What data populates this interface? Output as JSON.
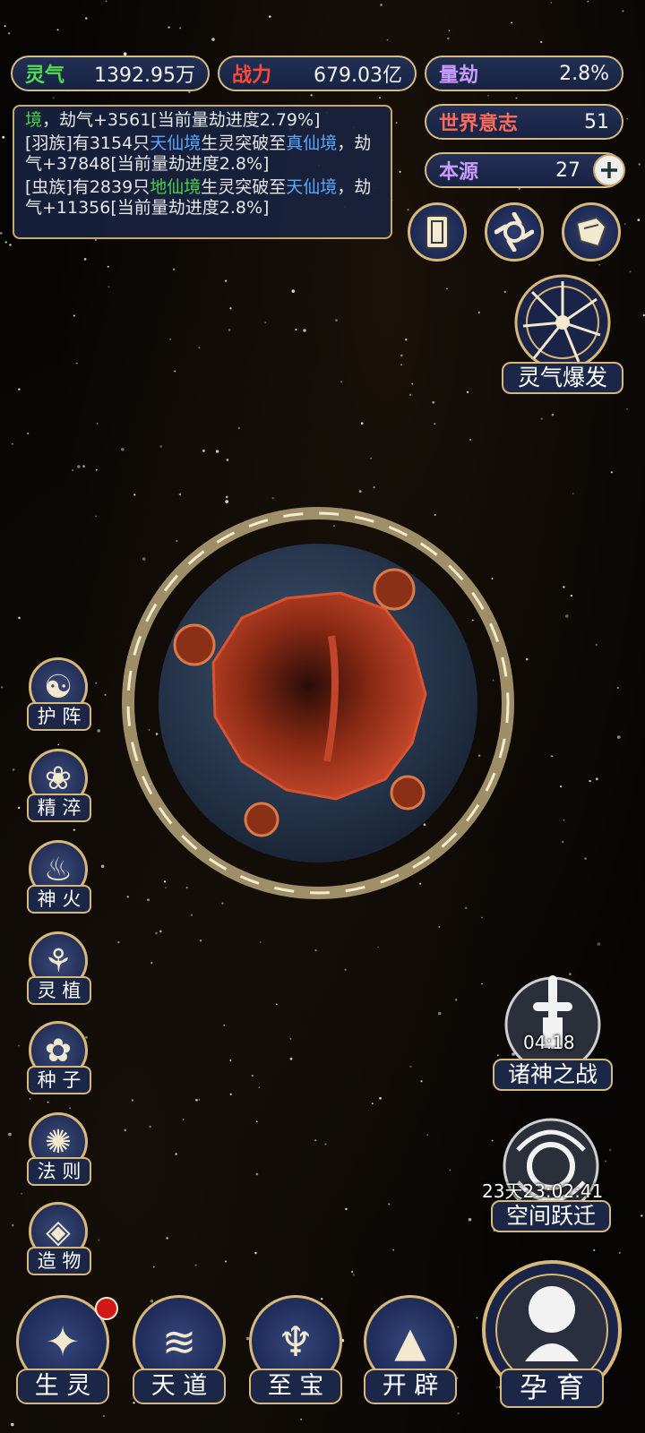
{
  "stats": {
    "lingqi": {
      "label": "灵气",
      "value": "1392.95万",
      "color": "#4fe04f"
    },
    "zhanli": {
      "label": "战力",
      "value": "679.03亿",
      "color": "#ff4a3a"
    },
    "liangjie": {
      "label": "量劫",
      "value": "2.8%",
      "color": "#c99bff"
    },
    "shijie": {
      "label": "世界意志",
      "value": "51",
      "color": "#ff6a5a"
    },
    "benyuan": {
      "label": "本源",
      "value": "27",
      "color": "#c99bff"
    }
  },
  "log": {
    "line1": {
      "a": "境",
      "b": "，劫气+3561[当前量劫进度2.79%]"
    },
    "line2": {
      "a": "[羽族]有3154只",
      "b": "天仙境",
      "c": "生灵突破至",
      "d": "真仙",
      "e": "境",
      "f": "，劫气+37848[当前量劫进度2.8%]"
    },
    "line3": {
      "a": "[虫族]有2839只",
      "b": "地仙境",
      "c": "生灵突破至",
      "d": "天仙",
      "e": "境",
      "f": "，劫气+11356[当前量劫进度2.8%]"
    }
  },
  "top_icons": [
    "card-icon",
    "vortex-icon",
    "scroll-icon"
  ],
  "burst": {
    "label": "灵气爆发"
  },
  "side_menu": [
    {
      "label": "护 阵",
      "icon": "yin-yang-icon"
    },
    {
      "label": "精 淬",
      "icon": "lotus-flame-icon"
    },
    {
      "label": "神 火",
      "icon": "fire-icon"
    },
    {
      "label": "灵 植",
      "icon": "plant-icon"
    },
    {
      "label": "种 子",
      "icon": "seed-flower-icon"
    },
    {
      "label": "法 则",
      "icon": "rune-icon"
    },
    {
      "label": "造 物",
      "icon": "diamond-icon"
    }
  ],
  "events": {
    "gods_war": {
      "label": "诸神之战",
      "timer": "04:18"
    },
    "space_jump": {
      "label": "空间跃迁",
      "timer": "23天23:02:41"
    }
  },
  "bottom_nav": [
    {
      "label": "生 灵",
      "badge": true
    },
    {
      "label": "天 道"
    },
    {
      "label": "至 宝"
    },
    {
      "label": "开 辟"
    }
  ],
  "nurture": {
    "label": "孕 育"
  }
}
